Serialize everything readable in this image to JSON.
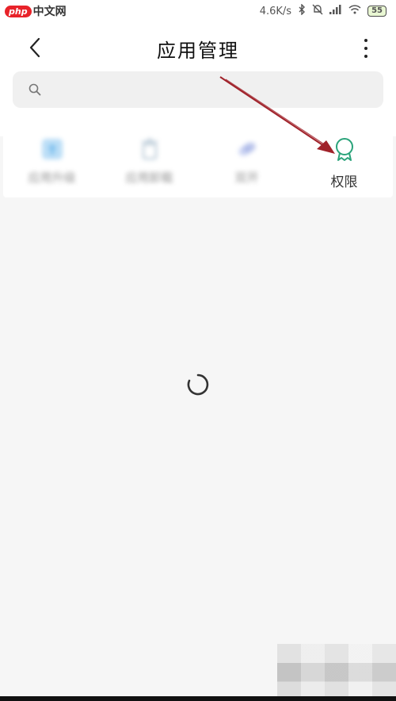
{
  "status_bar": {
    "watermark_badge": "php",
    "watermark_site": "中文网",
    "network_speed": "4.6K/s",
    "battery": "55"
  },
  "header": {
    "title": "应用管理",
    "back_icon": "chevron-left-icon",
    "more_icon": "more-vertical-icon"
  },
  "search": {
    "placeholder": "",
    "icon": "search-icon"
  },
  "tools": [
    {
      "label": "应用升级",
      "icon": "upgrade-icon",
      "color": "#4aa8e8"
    },
    {
      "label": "应用卸载",
      "icon": "trash-icon",
      "color": "#9fb6c8"
    },
    {
      "label": "双开",
      "icon": "dual-app-icon",
      "color": "#7a8ed8"
    },
    {
      "label": "权限",
      "icon": "permission-badge-icon",
      "color": "#2aa37a"
    }
  ],
  "loading": {
    "icon": "loading-spinner-icon"
  },
  "colors": {
    "accent": "#2aa37a",
    "annotation_arrow": "#a0222a"
  }
}
